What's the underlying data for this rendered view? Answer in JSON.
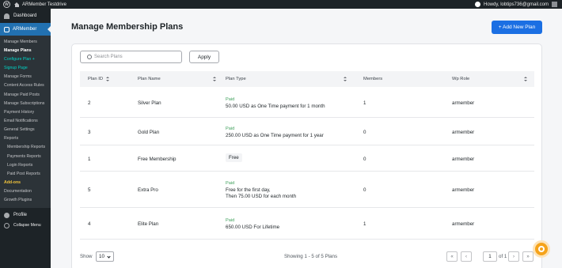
{
  "adminbar": {
    "site_name": "ARMember Testdrive",
    "greeting": "Howdy, lobtips736@gmail.com"
  },
  "sidebar": {
    "dashboard": "Dashboard",
    "armember": "ARMember",
    "submenu": [
      {
        "label": "Manage Members",
        "type": "normal"
      },
      {
        "label": "Manage Plans",
        "type": "current"
      },
      {
        "label": "Configure Plan +",
        "type": "green"
      },
      {
        "label": "Signup Page",
        "type": "green"
      },
      {
        "label": "Manage Forms",
        "type": "normal"
      },
      {
        "label": "Content Access Rules",
        "type": "normal"
      },
      {
        "label": "Manage Paid Posts",
        "type": "normal"
      },
      {
        "label": "Manage Subscriptions",
        "type": "normal"
      },
      {
        "label": "Payment History",
        "type": "normal"
      },
      {
        "label": "Email Notifications",
        "type": "normal"
      },
      {
        "label": "General Settings",
        "type": "normal"
      },
      {
        "label": "Reports",
        "type": "normal"
      },
      {
        "label": "Membership Reports",
        "type": "indent"
      },
      {
        "label": "Payments Reports",
        "type": "indent"
      },
      {
        "label": "Login Reports",
        "type": "indent"
      },
      {
        "label": "Paid Post Reports",
        "type": "indent"
      },
      {
        "label": "Add-ons",
        "type": "addon"
      },
      {
        "label": "Documentation",
        "type": "normal"
      },
      {
        "label": "Growth Plugins",
        "type": "normal"
      }
    ],
    "profile": "Profile",
    "collapse": "Collapse Menu"
  },
  "page": {
    "title": "Manage Membership Plans",
    "add_button": "+ Add New Plan",
    "search_placeholder": "Search Plans",
    "apply": "Apply"
  },
  "table": {
    "headers": {
      "plan_id": "Plan ID",
      "plan_name": "Plan Name",
      "plan_type": "Plan Type",
      "members": "Members",
      "wp_role": "Wp Role"
    },
    "rows": [
      {
        "id": "2",
        "name": "Silver Plan",
        "badge": "Paid",
        "desc1": "50.00 USD as One Time payment for 1 month",
        "desc2": "",
        "desc3": "",
        "members": "1",
        "role": "armember"
      },
      {
        "id": "3",
        "name": "Gold Plan",
        "badge": "Paid",
        "desc1": "250.00 USD as One Time payment for 1 year",
        "desc2": "",
        "desc3": "",
        "members": "0",
        "role": "armember"
      },
      {
        "id": "1",
        "name": "Free Membership",
        "badge": "",
        "desc1": "Free",
        "desc2": "",
        "desc3": "",
        "members": "0",
        "role": "armember"
      },
      {
        "id": "5",
        "name": "Extra Pro",
        "badge": "Paid",
        "desc1": "Free for the first day,",
        "desc2": "Then 75.00 USD for each month",
        "desc3": "",
        "members": "0",
        "role": "armember"
      },
      {
        "id": "4",
        "name": "Elite Plan",
        "badge": "Paid",
        "desc1": "650.00 USD For Lifetime",
        "desc2": "",
        "desc3": "",
        "members": "1",
        "role": "armember"
      }
    ]
  },
  "footer": {
    "show_label": "Show",
    "page_size": "10",
    "info": "Showing 1 - 5 of 5 Plans",
    "first": "«",
    "prev": "‹",
    "current_page": "1",
    "of": "of 1",
    "next": "›",
    "last": "»"
  },
  "colors": {
    "primary": "#1b6fe3",
    "sidebar": "#1d2327",
    "active_menu": "#2271b1",
    "paid_badge": "#3fa05b",
    "help_bubble": "#f5a31a"
  }
}
